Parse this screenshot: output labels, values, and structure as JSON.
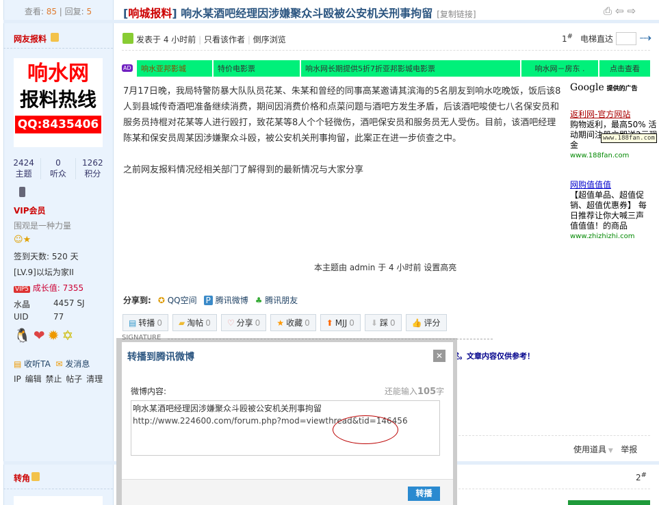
{
  "thread": {
    "views_label": "查看:",
    "views": "85",
    "replies_label": "回复:",
    "replies": "5",
    "tag": "响城报料",
    "title": "响水某酒吧经理因涉嫌聚众斗殴被公安机关刑事拘留",
    "copy_link": "[复制链接]"
  },
  "post_meta": {
    "posted": "发表于",
    "time": "4 小时前",
    "only_author": "只看该作者",
    "reverse": "倒序浏览",
    "floor": "1",
    "floor_mark": "#",
    "elevator": "电梯直达"
  },
  "ads": [
    "响水亚邦影城",
    "特价电影票",
    "响水网长期提供5折7折亚邦影城电影票",
    "响水网－房东 .",
    "点击查看"
  ],
  "ad_badge": "AD",
  "body": {
    "p1": "7月17日晚，我局特警防暴大队队员花某、朱某和曾经的同事高某邀请其滨海的5名朋友到响水吃晚饭，饭后该8人到县城传奇酒吧准备继续消费，期间因消费价格和点菜问题与酒吧方发生矛盾，后该酒吧唆使七八名保安员和服务员持棍对花某等人进行殴打，致花某等8人个个轻微伤，酒吧保安员和服务员无人受伤。目前，该酒吧经理陈某和保安员周某因涉嫌聚众斗殴，被公安机关刑事拘留，此案正在进一步侦查之中。",
    "p2": "之前网友报料情况经相关部门了解得到的最新情况与大家分享",
    "edited": "本主题由 admin 于 4 小时前 设置高亮"
  },
  "google": {
    "brand": "Google",
    "label": "提供的广告",
    "ads": [
      {
        "title": "返利网-官方网站",
        "text": "购物返利，最高50% 活动期间注册立即送2元现金",
        "url": "www.188fan.com"
      },
      {
        "title": "网购值值值",
        "text": "【超值单品、超值促销、超值优惠券】 每日推荐让你大喊三声 值值值！的商品",
        "url": "www.zhizhizhi.com"
      }
    ],
    "tooltip": "www.188fan.com"
  },
  "author": {
    "name": "网友报料",
    "logo_l1": "响水网",
    "logo_l2": "报料热线",
    "logo_qq": "QQ:8435406",
    "stats": [
      {
        "v": "2424",
        "l": "主题"
      },
      {
        "v": "0",
        "l": "听众"
      },
      {
        "v": "1262",
        "l": "积分"
      }
    ],
    "group": "VIP会员",
    "motto": "围观是一种力量",
    "checkin": "签到天数: 520 天",
    "level": "[LV.9]以坛为家II",
    "vip_badge": "VIP5",
    "growth": "成长值: 7355",
    "crystal_label": "水晶",
    "crystal": "4457 SJ",
    "uid_label": "UID",
    "uid": "77",
    "follow": "收听TA",
    "message": "发消息",
    "admin": [
      "IP",
      "编辑",
      "禁止",
      "帖子",
      "清理"
    ]
  },
  "share": {
    "label": "分享到:",
    "items": [
      "QQ空间",
      "腾讯微博",
      "腾讯朋友"
    ]
  },
  "actions": [
    {
      "l": "转播",
      "n": "0"
    },
    {
      "l": "淘帖",
      "n": "0"
    },
    {
      "l": "分享",
      "n": "0"
    },
    {
      "l": "收藏",
      "n": "0"
    },
    {
      "l": "MJJ",
      "n": "0"
    },
    {
      "l": "踩",
      "n": "0"
    },
    {
      "l": "评分",
      "n": ""
    }
  ],
  "signature": {
    "label": "SIGNATURE",
    "text": "述。文章内容仅供参考！"
  },
  "post_footer": {
    "tools": "使用道具",
    "report": "举报"
  },
  "post2": {
    "author": "转角",
    "floor": "2",
    "floor_mark": "#"
  },
  "modal": {
    "title": "转播到腾讯微博",
    "content_label": "微博内容:",
    "remain_pre": "还能输入",
    "remain": "105",
    "remain_post": "字",
    "text_line1": "响水某酒吧经理因涉嫌聚众斗殴被公安机关刑事拘留",
    "text_line2": "http://www.224600.com/forum.php?mod=viewthread&tid=146456",
    "submit": "转播"
  }
}
